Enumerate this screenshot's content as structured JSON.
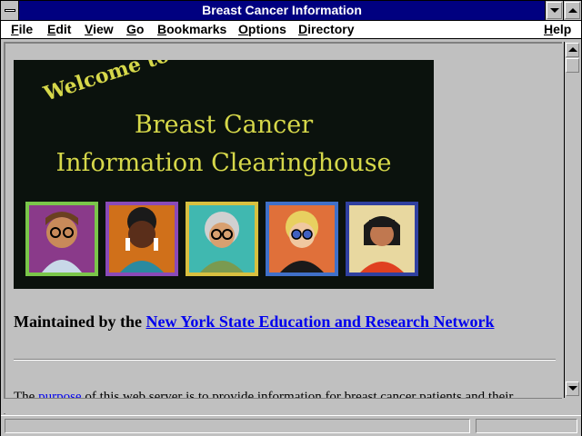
{
  "window": {
    "title": "Breast Cancer Information"
  },
  "menubar": {
    "items": [
      {
        "label": "File",
        "accel": "F",
        "rest": "ile"
      },
      {
        "label": "Edit",
        "accel": "E",
        "rest": "dit"
      },
      {
        "label": "View",
        "accel": "V",
        "rest": "iew"
      },
      {
        "label": "Go",
        "accel": "G",
        "rest": "o"
      },
      {
        "label": "Bookmarks",
        "accel": "B",
        "rest": "ookmarks"
      },
      {
        "label": "Options",
        "accel": "O",
        "rest": "ptions"
      },
      {
        "label": "Directory",
        "accel": "D",
        "rest": "irectory"
      },
      {
        "label": "Help",
        "accel": "H",
        "rest": "elp"
      }
    ]
  },
  "banner": {
    "welcome": "Welcome to the",
    "line1": "Breast Cancer",
    "line2": "Information Clearinghouse"
  },
  "content": {
    "maintained_prefix": "Maintained by the",
    "maintained_link": "New York State Education and Research Network",
    "para_prefix": "The",
    "para_link": "purpose",
    "para_suffix": "of this web server is to provide information for breast cancer patients and their"
  },
  "status": {
    "text": ""
  },
  "colors": {
    "titlebar": "#000080",
    "link": "#0000ee",
    "banner_text": "#d6d84a",
    "chrome": "#c0c0c0"
  }
}
